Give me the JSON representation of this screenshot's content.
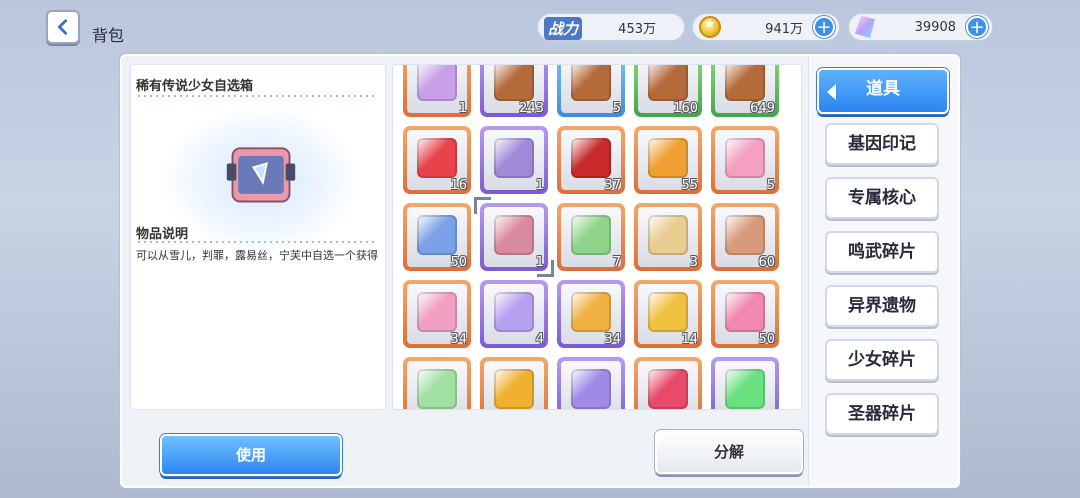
{
  "header": {
    "title": "背包",
    "power_label": "战力",
    "power_value": "453万",
    "coins_value": "941万",
    "gems_value": "39908"
  },
  "detail": {
    "item_name": "稀有传说少女自选箱",
    "desc_title": "物品说明",
    "desc_text": "可以从雪儿，判罪，露易丝，宁芙中自选一个获得"
  },
  "grid": {
    "rows": [
      [
        {
          "frame": "orange",
          "count": "1",
          "icon": "box-icon",
          "color": "#c9a0e8"
        },
        {
          "frame": "purple",
          "count": "243",
          "icon": "chest-icon",
          "color": "#b56a3a"
        },
        {
          "frame": "blue",
          "count": "5",
          "icon": "chest-icon",
          "color": "#b56a3a"
        },
        {
          "frame": "green",
          "count": "160",
          "icon": "chest-icon",
          "color": "#b56a3a"
        },
        {
          "frame": "green",
          "count": "649",
          "icon": "chest-icon",
          "color": "#b56a3a"
        }
      ],
      [
        {
          "frame": "orange",
          "count": "16",
          "icon": "red-box-icon",
          "color": "#e8424a"
        },
        {
          "frame": "purple",
          "count": "1",
          "icon": "gene-box-icon",
          "color": "#9f8ad8"
        },
        {
          "frame": "orange",
          "count": "37",
          "icon": "lucky-bag-icon",
          "color": "#c82a2a"
        },
        {
          "frame": "orange",
          "count": "55",
          "icon": "gold-box-icon",
          "color": "#f0a030"
        },
        {
          "frame": "orange",
          "count": "5",
          "icon": "gift-box-icon",
          "color": "#f4a0c0"
        }
      ],
      [
        {
          "frame": "orange",
          "count": "50",
          "icon": "toy-box-icon",
          "color": "#7aa0e8"
        },
        {
          "frame": "purple",
          "count": "1",
          "icon": "selector-box-icon",
          "color": "#d88aa0",
          "selected": true
        },
        {
          "frame": "orange",
          "count": "7",
          "icon": "green-crate-icon",
          "color": "#8fd48a"
        },
        {
          "frame": "orange",
          "count": "3",
          "icon": "beige-crate-icon",
          "color": "#e8cc90"
        },
        {
          "frame": "orange",
          "count": "60",
          "icon": "winged-box-icon",
          "color": "#d89a7a"
        }
      ],
      [
        {
          "frame": "orange",
          "count": "34",
          "icon": "ticket-icon",
          "color": "#f0a0c0"
        },
        {
          "frame": "purple",
          "count": "4",
          "icon": "smile-ticket-icon",
          "color": "#b8a0f0"
        },
        {
          "frame": "purple",
          "count": "34",
          "icon": "gene-card-icon",
          "color": "#f0b040"
        },
        {
          "frame": "orange",
          "count": "14",
          "icon": "gold-card-icon",
          "color": "#f0c040"
        },
        {
          "frame": "orange",
          "count": "50",
          "icon": "pink-card-icon",
          "color": "#f088b0"
        }
      ],
      [
        {
          "frame": "orange",
          "count": "",
          "icon": "rainbow-ticket-icon",
          "color": "#a0e0a0"
        },
        {
          "frame": "orange",
          "count": "",
          "icon": "sword-card-icon",
          "color": "#f0b030"
        },
        {
          "frame": "purple",
          "count": "",
          "icon": "blade-card-icon",
          "color": "#9f8ae8"
        },
        {
          "frame": "orange",
          "count": "",
          "icon": "crystal-icon",
          "color": "#e84a6a"
        },
        {
          "frame": "purple",
          "count": "",
          "icon": "potion-icon",
          "color": "#6ae080"
        }
      ]
    ]
  },
  "buttons": {
    "use": "使用",
    "split": "分解"
  },
  "tabs": [
    "道具",
    "基因印记",
    "专属核心",
    "鸣武碎片",
    "异界遗物",
    "少女碎片",
    "圣器碎片"
  ]
}
